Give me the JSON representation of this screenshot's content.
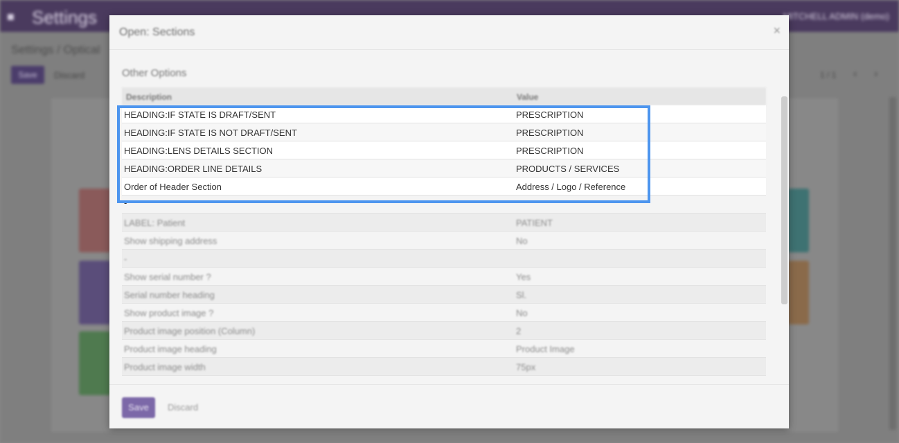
{
  "background": {
    "app_title": "Settings",
    "breadcrumb": "Settings / Optical",
    "save_label": "Save",
    "discard_label": "Discard",
    "pager": "1 / 1",
    "user_label": "MITCHELL ADMIN (demo)",
    "icons": {
      "menu": "menu-icon",
      "prev": "chevron-left-icon",
      "next": "chevron-right-icon"
    }
  },
  "modal": {
    "title": "Open: Sections",
    "close_icon": "close-icon",
    "section_title": "Other Options",
    "columns": {
      "description": "Description",
      "value": "Value"
    },
    "rows": [
      {
        "description": "HEADING:IF STATE IS DRAFT/SENT",
        "value": "PRESCRIPTION"
      },
      {
        "description": "HEADING:IF STATE IS NOT DRAFT/SENT",
        "value": "PRESCRIPTION"
      },
      {
        "description": "HEADING:LENS DETAILS SECTION",
        "value": "PRESCRIPTION"
      },
      {
        "description": "HEADING:ORDER LINE DETAILS",
        "value": "PRODUCTS / SERVICES"
      },
      {
        "description": "Order of Header Section",
        "value": "Address / Logo / Reference"
      },
      {
        "description": "-",
        "value": ""
      },
      {
        "description": "LABEL: Patient",
        "value": "PATIENT"
      },
      {
        "description": "Show shipping address",
        "value": "No"
      },
      {
        "description": "-",
        "value": ""
      },
      {
        "description": "Show serial number ?",
        "value": "Yes"
      },
      {
        "description": "Serial number heading",
        "value": "Sl."
      },
      {
        "description": "Show product image ?",
        "value": "No"
      },
      {
        "description": "Product image position (Column)",
        "value": "2"
      },
      {
        "description": "Product image heading",
        "value": "Product Image"
      },
      {
        "description": "Product image width",
        "value": "75px"
      }
    ],
    "footer": {
      "save_label": "Save",
      "discard_label": "Discard"
    }
  },
  "colors": {
    "accent": "#7c68a8",
    "highlight": "#4d95ee",
    "topbar": "#4a3a5e"
  }
}
